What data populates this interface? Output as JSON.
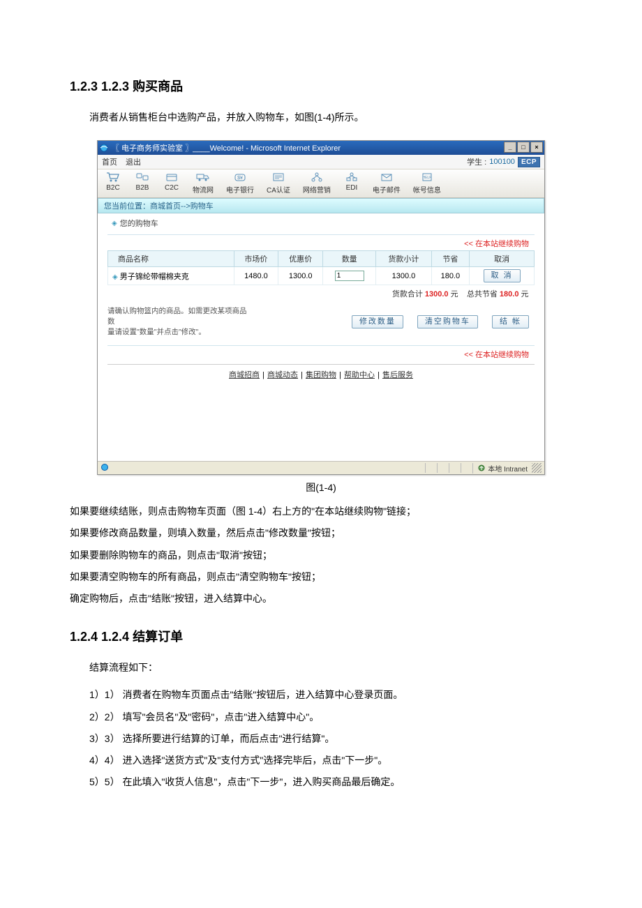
{
  "doc": {
    "h123": "1.2.3  1.2.3  购买商品",
    "intro": "消费者从销售柜台中选购产品，并放入购物车，如图(1-4)所示。",
    "figcaption": "图(1-4)",
    "lines": {
      "l1": "如果要继续结账，则点击购物车页面（图 1-4）右上方的\"在本站继续购物\"链接；",
      "l2": "如果要修改商品数量，则填入数量，然后点击\"修改数量\"按钮；",
      "l3": "如果要删除购物车的商品，则点击\"取消\"按钮；",
      "l4": "如果要清空购物车的所有商品，则点击\"清空购物车\"按钮；",
      "l5": "确定购物后，点击\"结账\"按钮，进入结算中心。"
    },
    "h124": "1.2.4  1.2.4  结算订单",
    "flow_intro": "结算流程如下：",
    "steps": {
      "s1": "1）1） 消费者在购物车页面点击\"结账\"按钮后，进入结算中心登录页面。",
      "s2": "2）2） 填写\"会员名\"及\"密码\"，点击\"进入结算中心\"。",
      "s3": "3）3） 选择所要进行结算的订单，而后点击\"进行结算\"。",
      "s4": "4）4） 进入选择\"送货方式\"及\"支付方式\"选择完毕后，点击\"下一步\"。",
      "s5": "5）5） 在此填入\"收货人信息\"，点击\"下一步\"，进入购买商品最后确定。"
    }
  },
  "ie": {
    "title": "〖 电子商务师实验室 〗____Welcome! - Microsoft Internet Explorer",
    "menu": {
      "home": "首页",
      "exit": "退出",
      "student": "学生 :",
      "student_id": "100100",
      "ecp": "ECP"
    },
    "toolbar": {
      "b2c": "B2C",
      "b2b": "B2B",
      "c2c": "C2C",
      "wuliu": "物流网",
      "ebank": "电子银行",
      "ca": "CA认证",
      "wlmk": "网络营销",
      "edi": "EDI",
      "mail": "电子邮件",
      "account": "帐号信息"
    },
    "breadcrumb": "您当前位置：商城首页-->购物车",
    "cart_title": "您的购物车",
    "continue": "<< 在本站继续购物",
    "table": {
      "h_name": "商品名称",
      "h_market": "市场价",
      "h_promo": "优惠价",
      "h_qty": "数量",
      "h_sub": "货款小计",
      "h_save": "节省",
      "h_cancel": "取消",
      "item_name": "男子锦纶带帽棉夹克",
      "market": "1480.0",
      "promo": "1300.0",
      "qty": "1",
      "subtotal": "1300.0",
      "save": "180.0",
      "btn_cancel": "取 消"
    },
    "totals": {
      "sum_label": "货款合计",
      "sum": "1300.0",
      "sum_unit": "元",
      "save_label": "总共节省",
      "save": "180.0",
      "save_unit": "元"
    },
    "hint1": "请确认购物篮内的商品。如需更改某项商品数",
    "hint2": "量请设置\"数量\"并点击\"修改\"。",
    "btns": {
      "modify": "修改数量",
      "clear": "清空购物车",
      "checkout": "结 帐"
    },
    "footer": {
      "a1": "商城招商",
      "a2": "商城动态",
      "a3": "集团购物",
      "a4": "帮助中心",
      "a5": "售后服务",
      "sep": " | "
    },
    "status": "本地 Intranet"
  }
}
